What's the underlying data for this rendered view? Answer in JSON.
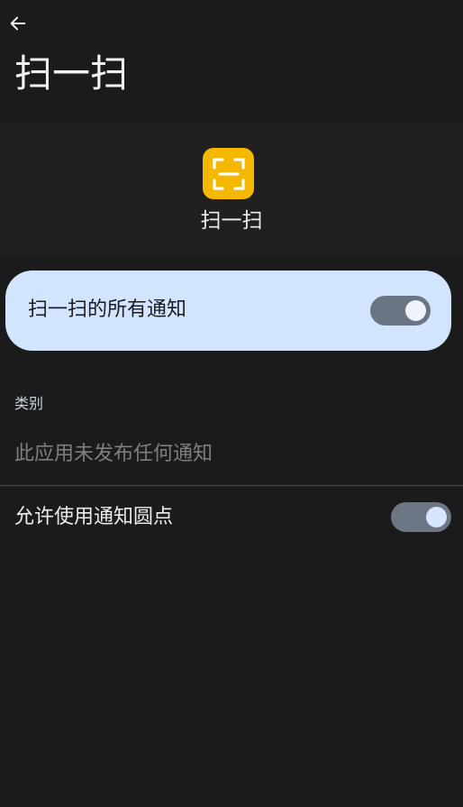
{
  "header": {
    "back_icon": "arrow-left-icon",
    "title": "扫一扫"
  },
  "app": {
    "icon": "scan-frame-icon",
    "icon_color": "#f5b800",
    "name": "扫一扫"
  },
  "all_notifications": {
    "label": "扫一扫的所有通知",
    "enabled": true,
    "card_color": "#d3e4ff"
  },
  "categories": {
    "section_label": "类别",
    "empty_text": "此应用未发布任何通知"
  },
  "badge_dot": {
    "label": "允许使用通知圆点",
    "enabled": true
  }
}
